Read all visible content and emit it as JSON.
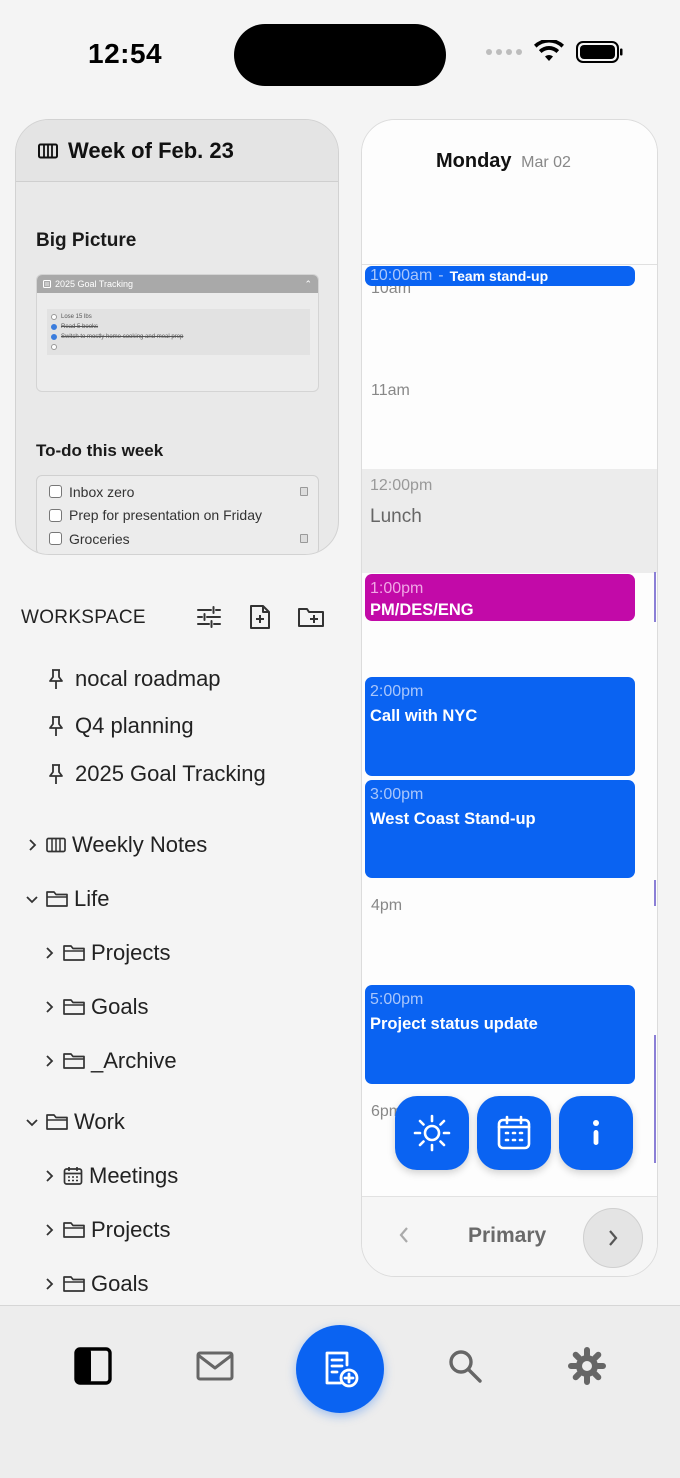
{
  "status_bar": {
    "time": "12:54"
  },
  "weekly_card": {
    "title": "Week of Feb. 23",
    "big_picture_heading": "Big Picture",
    "embed": {
      "title": "2025 Goal Tracking",
      "items": [
        {
          "label": "Lose 15 lbs",
          "done": false
        },
        {
          "label": "Read 5 books",
          "done": true
        },
        {
          "label": "Switch to mostly home cooking and meal prep",
          "done": true
        },
        {
          "label": "",
          "done": false
        }
      ]
    },
    "todo_heading": "To-do this week",
    "todos": [
      {
        "label": "Inbox zero",
        "done": false
      },
      {
        "label": "Prep for presentation on Friday",
        "done": false
      },
      {
        "label": "Groceries",
        "done": false
      }
    ]
  },
  "workspace": {
    "label": "WORKSPACE",
    "pinned": [
      "nocal roadmap",
      "Q4 planning",
      "2025 Goal Tracking"
    ],
    "tree": {
      "weekly_notes": "Weekly Notes",
      "life": "Life",
      "life_projects": "Projects",
      "life_goals": "Goals",
      "life_archive": "_Archive",
      "work": "Work",
      "work_meetings": "Meetings",
      "work_projects": "Projects",
      "work_goals": "Goals"
    }
  },
  "calendar": {
    "day": "Monday",
    "date": "Mar 02",
    "hours": {
      "h10": "10am",
      "h11": "11am",
      "h4": "4pm",
      "h6": "6pm"
    },
    "lunch": {
      "time": "12:00pm",
      "title": "Lunch"
    },
    "events": {
      "standup": {
        "time": "10:00am",
        "sep": "-",
        "title": "Team stand-up"
      },
      "pmdes": {
        "time": "1:00pm",
        "title": "PM/DES/ENG"
      },
      "nyc": {
        "time": "2:00pm",
        "title": "Call with NYC"
      },
      "west": {
        "time": "3:00pm",
        "title": "West Coast Stand-up"
      },
      "status": {
        "time": "5:00pm",
        "title": "Project status update"
      }
    },
    "footer_label": "Primary"
  },
  "colors": {
    "accent": "#0a63f2",
    "pink_event": "#c20aa8",
    "lunch_bg": "#ececec"
  },
  "icons": [
    "sidebar-icon",
    "mail-icon",
    "new-note-icon",
    "search-icon",
    "settings-icon",
    "sun-icon",
    "calendar-icon",
    "more-icon"
  ]
}
